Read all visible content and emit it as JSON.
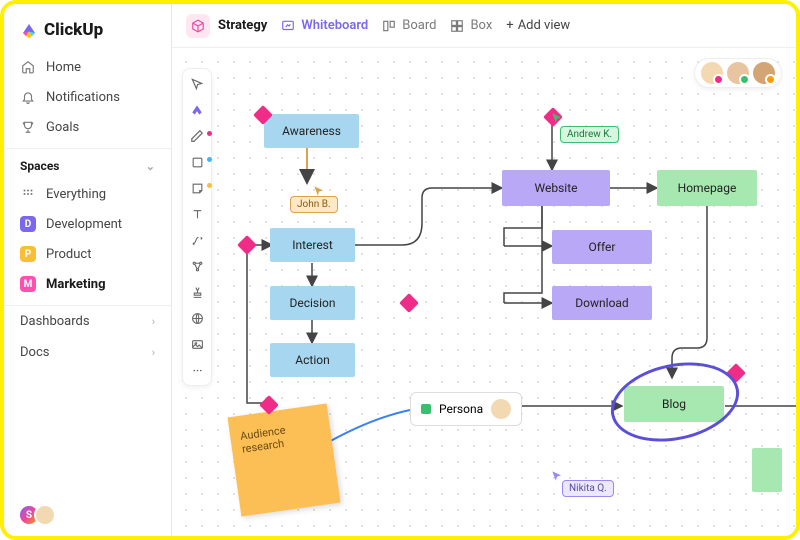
{
  "brand": "ClickUp",
  "nav": {
    "home": "Home",
    "notifications": "Notifications",
    "goals": "Goals"
  },
  "spaces": {
    "header": "Spaces",
    "everything": "Everything",
    "items": [
      {
        "letter": "D",
        "label": "Development",
        "color": "#7b68ee"
      },
      {
        "letter": "P",
        "label": "Product",
        "color": "#f9be34"
      },
      {
        "letter": "M",
        "label": "Marketing",
        "color": "#ff4fb0"
      }
    ]
  },
  "sections": {
    "dashboards": "Dashboards",
    "docs": "Docs"
  },
  "topbar": {
    "crumb": "Strategy",
    "views": {
      "whiteboard": "Whiteboard",
      "board": "Board",
      "box": "Box"
    },
    "add": "Add view"
  },
  "nodes": {
    "awareness": "Awareness",
    "interest": "Interest",
    "decision": "Decision",
    "action": "Action",
    "website": "Website",
    "offer": "Offer",
    "download": "Download",
    "homepage": "Homepage",
    "blog": "Blog",
    "persona": "Persona"
  },
  "sticky": "Audience research",
  "users": {
    "john": "John B.",
    "andrew": "Andrew K.",
    "nikita": "Nikita Q."
  },
  "presence_initial": "S"
}
